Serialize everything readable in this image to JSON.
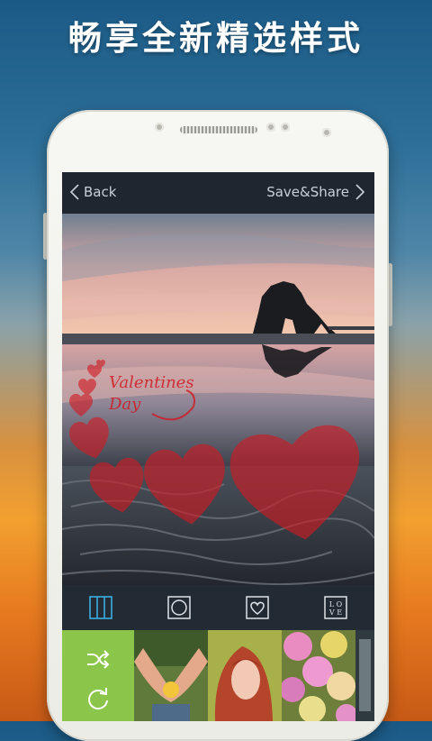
{
  "headline": "畅享全新精选样式",
  "topbar": {
    "back_label": "Back",
    "save_label": "Save&Share"
  },
  "overlay": {
    "valentine_line1": "Valentines",
    "valentine_line2": "Day"
  },
  "toolbar": {
    "tools": [
      {
        "icon": "grid-columns-icon",
        "active": true
      },
      {
        "icon": "circle-frame-icon",
        "active": false
      },
      {
        "icon": "heart-frame-icon",
        "active": false
      },
      {
        "icon": "love-text-icon",
        "active": false,
        "text_top": "L O",
        "text_bottom": "V E"
      }
    ]
  },
  "strip": {
    "shuffle_tile_icons": [
      "shuffle-icon",
      "refresh-icon"
    ],
    "thumbnails": [
      "hands-holding-flower",
      "girl-with-red-hair",
      "pink-and-yellow-roses",
      "partial-thumbnail"
    ]
  },
  "colors": {
    "accent": "#3ab0e2",
    "heart": "#d11a22",
    "shuffle_tile": "#8bc64a"
  }
}
